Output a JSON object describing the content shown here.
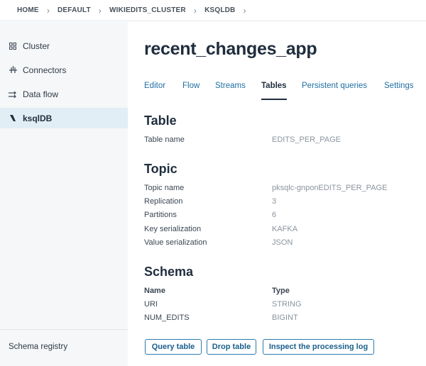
{
  "breadcrumb": [
    "HOME",
    "DEFAULT",
    "WIKIEDITS_CLUSTER",
    "KSQLDB"
  ],
  "sidebar": {
    "items": [
      {
        "label": "Cluster",
        "icon": "grid-icon"
      },
      {
        "label": "Connectors",
        "icon": "connectors-icon"
      },
      {
        "label": "Data flow",
        "icon": "data-flow-icon"
      },
      {
        "label": "ksqlDB",
        "icon": "ksqldb-icon",
        "active": true
      }
    ],
    "footer": "Schema registry"
  },
  "app": {
    "title": "recent_changes_app"
  },
  "tabs": [
    {
      "label": "Editor"
    },
    {
      "label": "Flow"
    },
    {
      "label": "Streams"
    },
    {
      "label": "Tables",
      "active": true
    },
    {
      "label": "Persistent queries"
    },
    {
      "label": "Settings"
    }
  ],
  "table_section": {
    "heading": "Table",
    "rows": [
      {
        "key": "Table name",
        "value": "EDITS_PER_PAGE"
      }
    ]
  },
  "topic_section": {
    "heading": "Topic",
    "rows": [
      {
        "key": "Topic name",
        "value": "pksqlc-gnponEDITS_PER_PAGE"
      },
      {
        "key": "Replication",
        "value": "3"
      },
      {
        "key": "Partitions",
        "value": "6"
      },
      {
        "key": "Key serialization",
        "value": "KAFKA"
      },
      {
        "key": "Value serialization",
        "value": "JSON"
      }
    ]
  },
  "schema_section": {
    "heading": "Schema",
    "columns": [
      "Name",
      "Type"
    ],
    "rows": [
      {
        "key": "URI",
        "value": "STRING"
      },
      {
        "key": "NUM_EDITS",
        "value": "BIGINT"
      }
    ]
  },
  "actions": {
    "query_table": "Query table",
    "drop_table": "Drop table",
    "inspect_log": "Inspect the processing log"
  },
  "colors": {
    "accent": "#1f6fa3",
    "sidebar_bg": "#f5f7f9",
    "active_nav_bg": "#e2eef6",
    "button_border": "#2a7bb0"
  }
}
